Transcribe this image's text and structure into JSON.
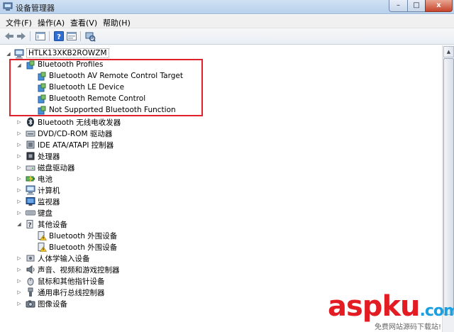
{
  "window": {
    "title": "设备管理器",
    "minimize": "–",
    "maximize": "□",
    "close": "x"
  },
  "menu": [
    "文件(F)",
    "操作(A)",
    "查看(V)",
    "帮助(H)"
  ],
  "toolbar": [
    "back-icon",
    "forward-icon",
    "show-hide-console-icon",
    "help-icon",
    "properties-icon",
    "scan-hardware-icon"
  ],
  "tree": {
    "root": "HTLK13XKB2ROWZM",
    "bt_profiles": {
      "label": "Bluetooth Profiles",
      "children": [
        "Bluetooth AV Remote Control Target",
        "Bluetooth LE Device",
        "Bluetooth Remote Control",
        "Not Supported Bluetooth Function"
      ]
    },
    "categories": [
      "Bluetooth 无线电收发器",
      "DVD/CD-ROM 驱动器",
      "IDE ATA/ATAPI 控制器",
      "处理器",
      "磁盘驱动器",
      "电池",
      "计算机",
      "监视器",
      "键盘"
    ],
    "other_devices": {
      "label": "其他设备",
      "children": [
        "Bluetooth 外围设备",
        "Bluetooth 外围设备"
      ]
    },
    "categories_tail": [
      "人体学输入设备",
      "声音、视频和游戏控制器",
      "鼠标和其他指针设备",
      "通用串行总线控制器",
      "图像设备"
    ]
  },
  "watermark": {
    "logo_a": "asp",
    "logo_b": "ku",
    "logo_c": ".com",
    "sub": "免费网站源码下载站!"
  },
  "colors": {
    "highlight": "#e0202a",
    "watermark_red": "#e31b23",
    "watermark_blue": "#1aa0e0"
  }
}
